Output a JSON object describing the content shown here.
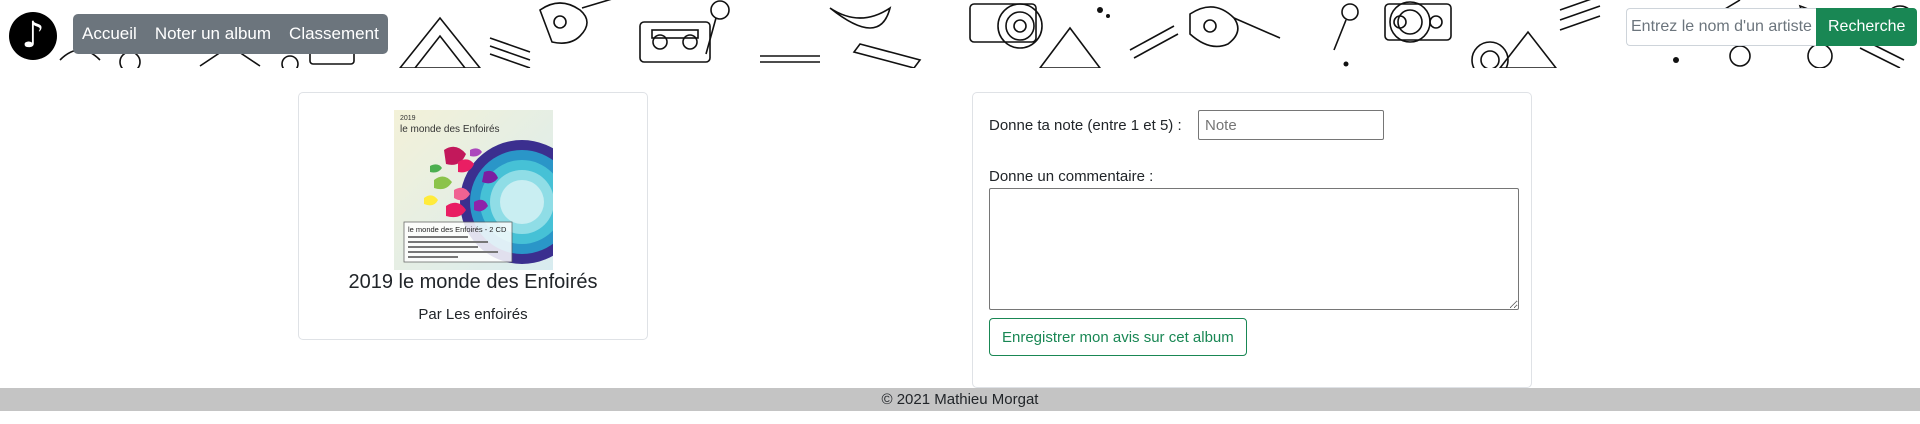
{
  "nav": {
    "logo_icon": "music-note-icon",
    "items": [
      {
        "label": "Accueil"
      },
      {
        "label": "Noter un album"
      },
      {
        "label": "Classement"
      }
    ]
  },
  "search": {
    "placeholder": "Entrez le nom d'un artiste",
    "button_label": "Recherche"
  },
  "album": {
    "cover_text_year": "2019",
    "cover_text_title": "le monde des Enfoirés",
    "cover_text_banner": "le monde des Enfoirés - 2 CD",
    "title": "2019 le monde des Enfoirés",
    "artist_line": "Par Les enfoirés"
  },
  "review": {
    "rating_label": "Donne ta note (entre 1 et 5) :",
    "rating_placeholder": "Note",
    "comment_label": "Donne un commentaire :",
    "submit_label": "Enregistrer mon avis sur cet album"
  },
  "footer": {
    "text": "© 2021 Mathieu Morgat"
  },
  "colors": {
    "nav_button": "#6c757d",
    "search_button": "#198754",
    "submit_outline": "#198754",
    "footer_bg": "#c4c4c4"
  }
}
